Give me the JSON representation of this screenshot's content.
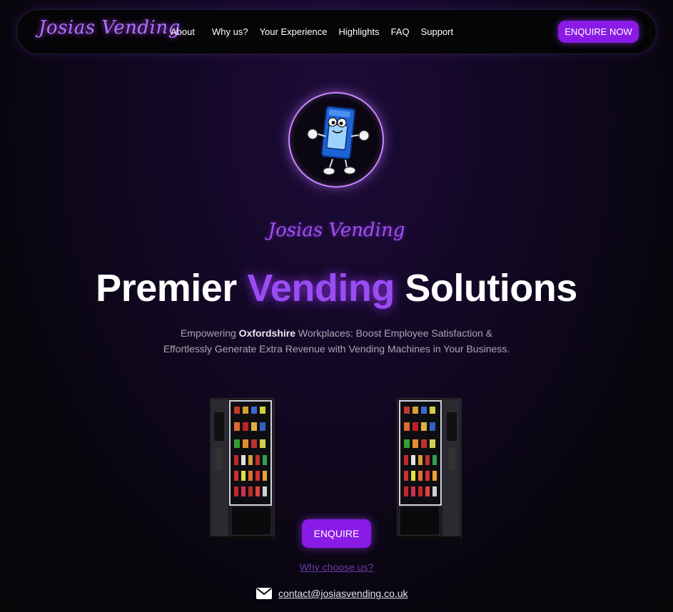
{
  "nav": {
    "brand": "Josias Vending",
    "links": [
      "About",
      "Why us?",
      "Your Experience",
      "Highlights",
      "FAQ",
      "Support"
    ],
    "cta": "ENQUIRE NOW"
  },
  "hero": {
    "logo_icon": "vending-machine-mascot-icon",
    "subbrand": "Josias Vending",
    "headline_pre": "Premier ",
    "headline_accent": "Vending",
    "headline_post": " Solutions",
    "tagline_pre": "Empowering ",
    "tagline_bold": "Oxfordshire",
    "tagline_post": " Workplaces: Boost Employee Satisfaction & Effortlessly Generate Extra Revenue with Vending Machines in Your Business.",
    "cta": "ENQUIRE",
    "secondary_link": "Why choose us?",
    "contact_icon": "mail-icon",
    "email": "contact@josiasvending.co.uk"
  },
  "colors": {
    "accent": "#8a1be6",
    "accent_text": "#9a4cf4",
    "background": "#0a0612"
  }
}
